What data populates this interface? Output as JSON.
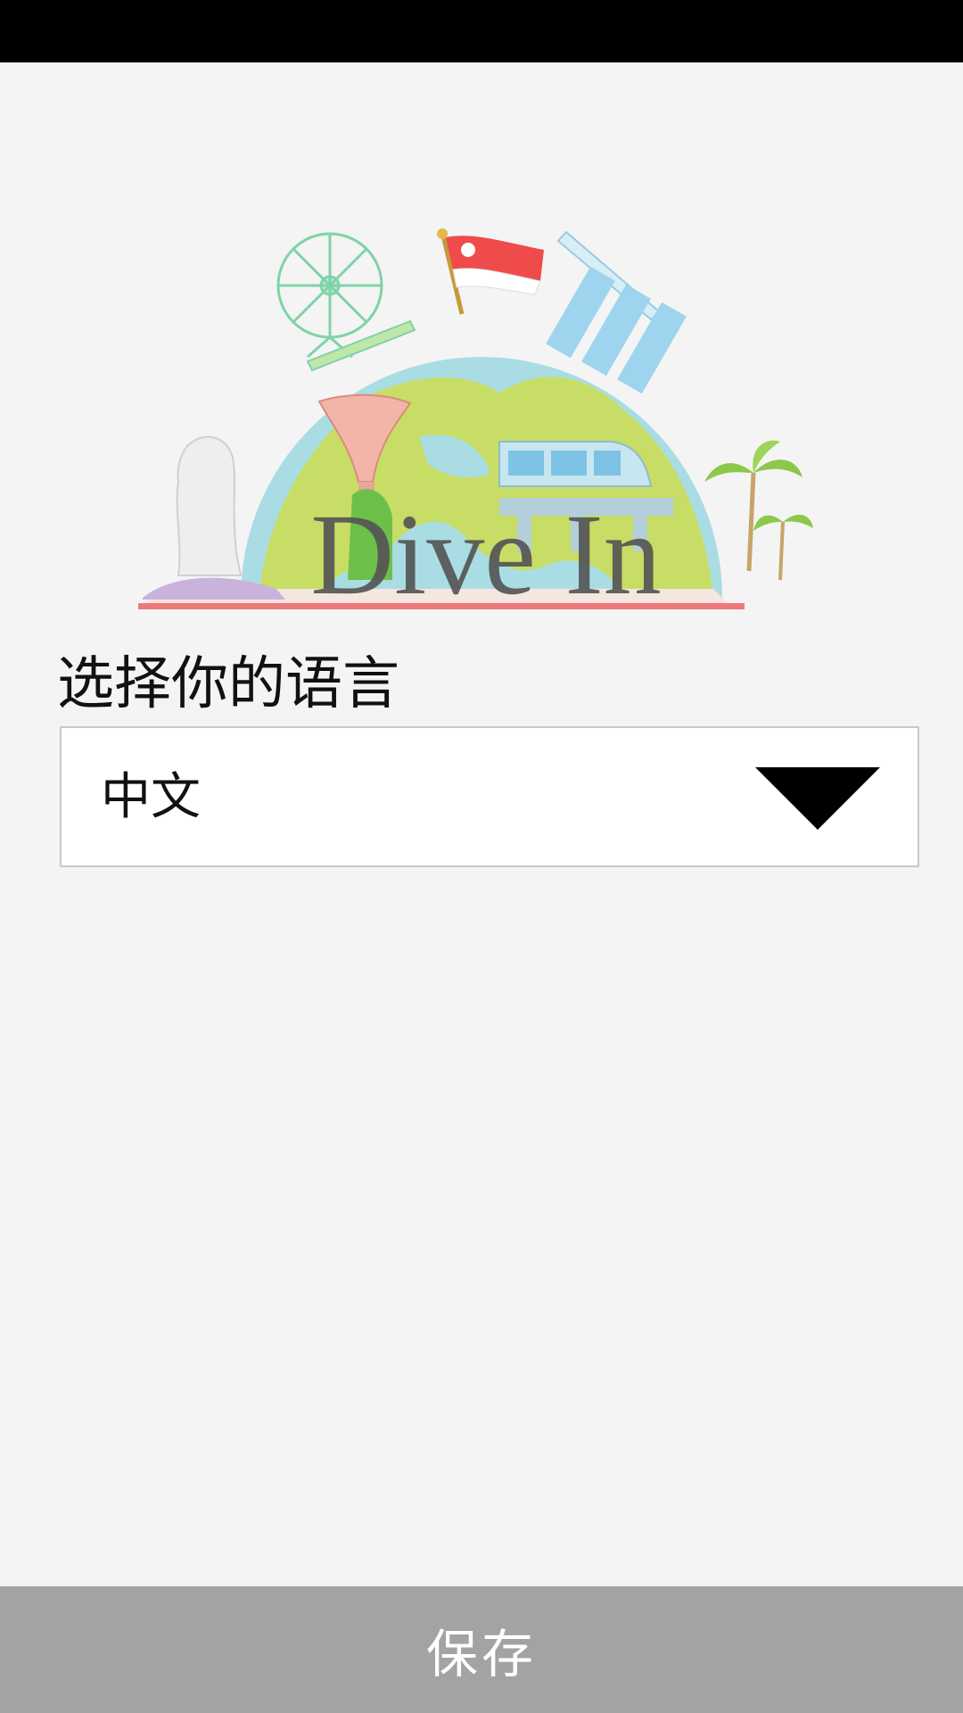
{
  "hero": {
    "logo_text": "Dive In"
  },
  "language_section": {
    "label": "选择你的语言",
    "selected_language": "中文"
  },
  "footer": {
    "save_label": "保存"
  },
  "colors": {
    "background": "#f4f4f4",
    "status_bar": "#000000",
    "save_bar": "#a3a3a3",
    "globe_land": "#c9dc5e",
    "globe_sea": "#a9dde3",
    "flag_red": "#ef4b4b"
  }
}
